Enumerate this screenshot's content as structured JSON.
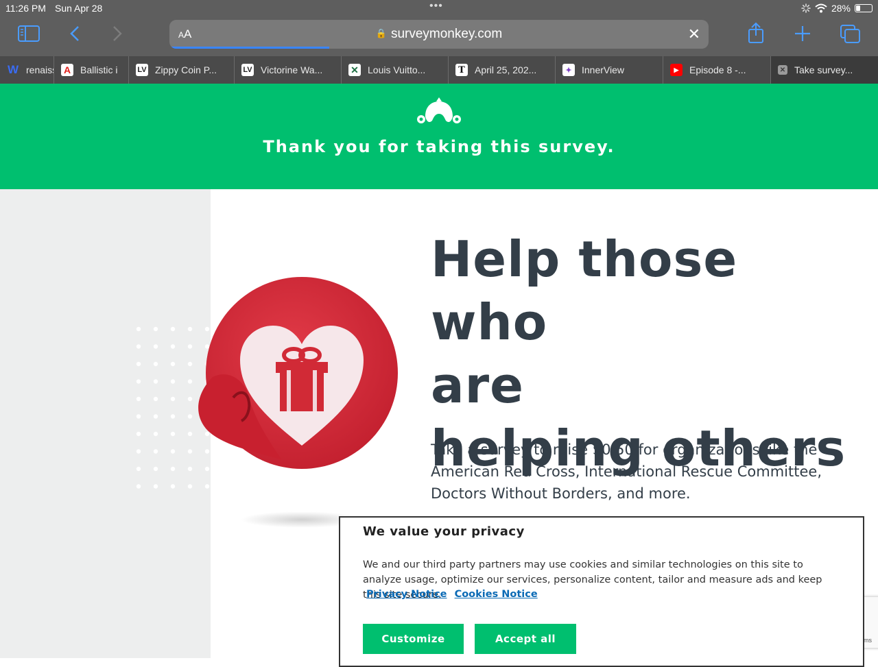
{
  "status_bar": {
    "time": "11:26 PM",
    "date": "Sun Apr 28",
    "battery": "28%",
    "battery_level": 0.28
  },
  "browser": {
    "text_size_label_small": "A",
    "text_size_label_large": "A",
    "url_host": "surveymonkey.com",
    "accent_color": "#4a9cff",
    "tabs": [
      {
        "label": "renaiss",
        "icon": "weebly-icon"
      },
      {
        "label": "Ballistic i",
        "icon": "adobe-icon"
      },
      {
        "label": "Zippy Coin P...",
        "icon": "louis-vuitton-icon"
      },
      {
        "label": "Victorine Wa...",
        "icon": "louis-vuitton-icon"
      },
      {
        "label": "Louis Vuitto...",
        "icon": "excel-icon"
      },
      {
        "label": "April 25, 202...",
        "icon": "nytimes-icon"
      },
      {
        "label": "InnerView",
        "icon": "innerview-icon"
      },
      {
        "label": "Episode 8 -...",
        "icon": "youtube-icon"
      },
      {
        "label": "Take survey...",
        "icon": "close-icon"
      }
    ]
  },
  "banner": {
    "title": "Thank you for taking this survey.",
    "color": "#00bf6f"
  },
  "main": {
    "headline_line1": "Help those who",
    "headline_line2": "are",
    "headline_line3": "helping others",
    "description": "Take a survey to raise $0.50 for organizations like the American Red Cross, International Rescue Committee, Doctors Without Borders, and more."
  },
  "cookie_dialog": {
    "title": "We value your privacy",
    "description": "We and our third party partners may use cookies and similar technologies on this site to analyze usage, optimize our services, personalize content, tailor and measure ads and keep this site secure.",
    "privacy_link": "Privacy Notice",
    "cookies_link": "Cookies Notice",
    "customize_label": "Customize",
    "accept_label": "Accept all"
  },
  "recaptcha": {
    "fragment": "ms"
  }
}
